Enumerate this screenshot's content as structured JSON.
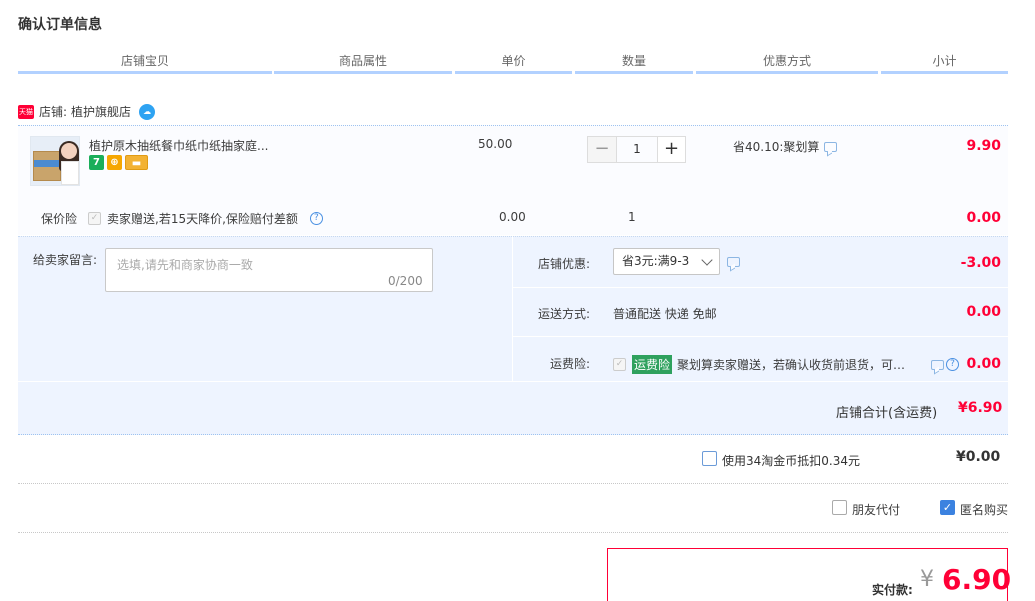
{
  "page_title": "确认订单信息",
  "columns": [
    "店铺宝贝",
    "商品属性",
    "单价",
    "数量",
    "优惠方式",
    "小计"
  ],
  "shop": {
    "badge": "天猫",
    "label": "店铺:",
    "name": "植护旗舰店",
    "chat_icon": "wangwang-icon"
  },
  "item": {
    "title": "植护原木抽纸餐巾纸巾纸抽家庭...",
    "unit_price": "50.00",
    "quantity": "1",
    "qty_minus": "−",
    "qty_plus": "+",
    "discount": "省40.10:聚划算",
    "subtotal": "9.90",
    "service_icons": [
      "7",
      "⊕",
      "▬"
    ]
  },
  "insurance": {
    "label": "保价险",
    "text": "卖家赠送,若15天降价,保险赔付差额",
    "price": "0.00",
    "qty": "1",
    "subtotal": "0.00"
  },
  "note": {
    "label": "给卖家留言:",
    "placeholder": "选填,请先和商家协商一致",
    "count": "0/200"
  },
  "shop_coupon": {
    "label": "店铺优惠:",
    "selected": "省3元:满9-3",
    "amount": "-3.00"
  },
  "shipping": {
    "label": "运送方式:",
    "method": "普通配送 快递 免邮",
    "amount": "0.00"
  },
  "freight_insurance": {
    "label": "运费险:",
    "tag": "运费险",
    "desc": "聚划算卖家赠送，若确认收货前退货，可获...",
    "amount": "0.00"
  },
  "shop_total": {
    "label": "店铺合计(含运费)",
    "value": "¥6.90"
  },
  "coins": {
    "label": "使用34淘金币抵扣0.34元",
    "value": "¥0.00",
    "checked": false
  },
  "options": {
    "friend_pay": "朋友代付",
    "anonymous": "匿名购买"
  },
  "payment": {
    "label": "实付款:",
    "currency": "¥",
    "amount": "6.90"
  },
  "colors": {
    "accent_red": "#ff0036",
    "header_line": "#b2d1ff",
    "panel_bg": "#eef4ff"
  }
}
